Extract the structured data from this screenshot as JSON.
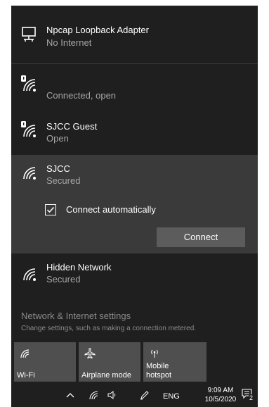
{
  "networks": [
    {
      "name": "Npcap Loopback Adapter",
      "status": "No Internet",
      "icon": "ethernet-icon"
    },
    {
      "name": "",
      "status": "Connected, open",
      "icon": "wifi-open-icon"
    },
    {
      "name": "SJCC Guest",
      "status": "Open",
      "icon": "wifi-open-icon"
    },
    {
      "name": "SJCC",
      "status": "Secured",
      "icon": "wifi-icon"
    },
    {
      "name": "Hidden Network",
      "status": "Secured",
      "icon": "wifi-icon"
    }
  ],
  "selected_network": {
    "connect_auto_label": "Connect automatically",
    "connect_auto_checked": true,
    "connect_button": "Connect"
  },
  "settings": {
    "title": "Network & Internet settings",
    "description": "Change settings, such as making a connection metered."
  },
  "quick_actions": [
    {
      "label": "Wi-Fi",
      "icon": "wifi-icon"
    },
    {
      "label": "Airplane mode",
      "icon": "airplane-icon"
    },
    {
      "label": "Mobile hotspot",
      "icon": "hotspot-icon"
    }
  ],
  "taskbar": {
    "language": "ENG",
    "time": "9:09 AM",
    "date": "10/5/2020",
    "notification_count": "2"
  },
  "colors": {
    "flyout_bg": "#1f1f1f",
    "selected_bg": "#3a3a3a",
    "tile_bg": "#4f4f4f",
    "button_bg": "#5c5c5c"
  }
}
